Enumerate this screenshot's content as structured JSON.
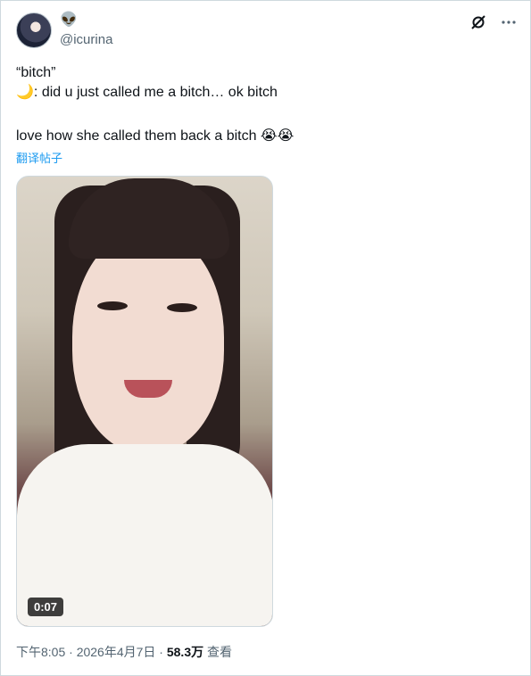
{
  "user": {
    "badge_emoji": "👽",
    "handle": "@icurina"
  },
  "tweet": {
    "line1": "“bitch”",
    "line2": "🌙: did u just called me a bitch… ok bitch",
    "line3": "love how she called them back a bitch 😭😭",
    "translate": "翻译帖子"
  },
  "media": {
    "duration": "0:07"
  },
  "meta": {
    "time": "下午8:05 · 2026年4月7日 · ",
    "views_count": "58.3万",
    "views_label": " 查看"
  },
  "icons": {
    "grok": "grok-icon",
    "more": "more-icon"
  }
}
